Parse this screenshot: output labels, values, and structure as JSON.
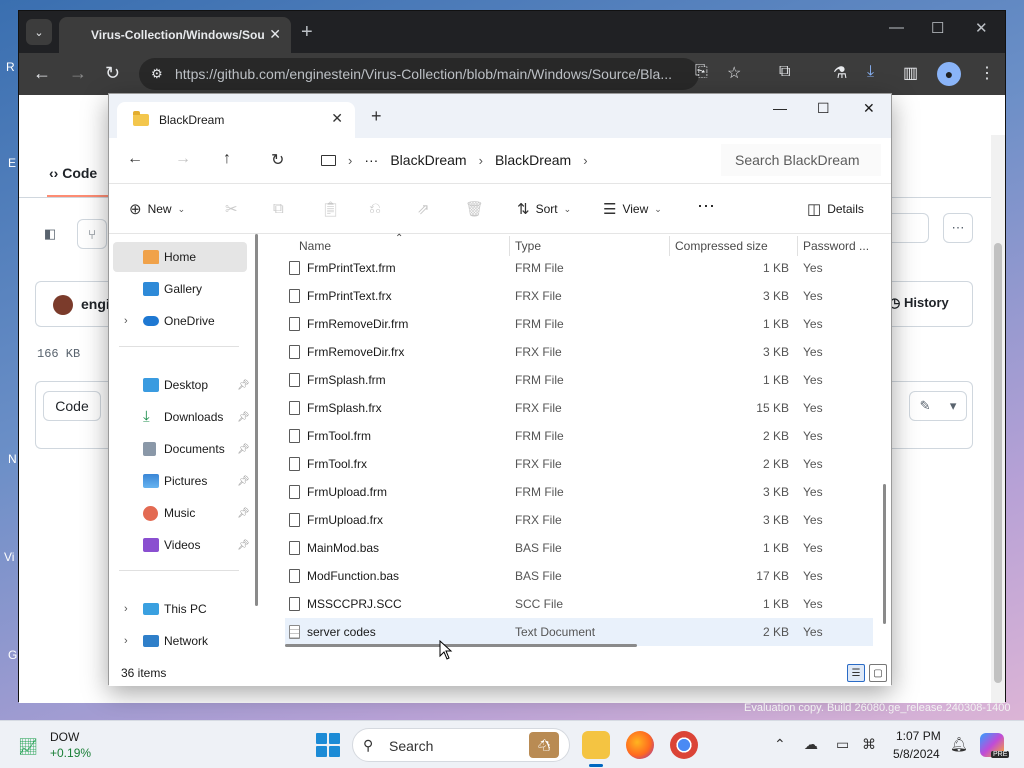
{
  "desktop": {
    "edge_letters": [
      "R",
      "E",
      "N",
      "Vi",
      "G"
    ]
  },
  "browser": {
    "tab_title": "Virus-Collection/Windows/Sou",
    "url": "https://github.com/enginestein/Virus-Collection/blob/main/Windows/Source/Bla..."
  },
  "github": {
    "code_tab": "Code",
    "author": "engi",
    "file_size": "166 KB",
    "code_button": "Code",
    "history": "History"
  },
  "explorer": {
    "tab_title": "BlackDream",
    "breadcrumb": [
      "BlackDream",
      "BlackDream"
    ],
    "search_placeholder": "Search BlackDream",
    "cmd": {
      "new": "New",
      "sort": "Sort",
      "view": "View",
      "details": "Details"
    },
    "nav": [
      {
        "label": "Home",
        "icon": "home-icon",
        "selected": true
      },
      {
        "label": "Gallery",
        "icon": "gallery-icon"
      },
      {
        "label": "OneDrive",
        "icon": "cloud-icon",
        "expandable": true
      },
      {
        "label": "Desktop",
        "icon": "desktop-icon",
        "pinned": true
      },
      {
        "label": "Downloads",
        "icon": "download-icon",
        "pinned": true
      },
      {
        "label": "Documents",
        "icon": "documents-icon",
        "pinned": true
      },
      {
        "label": "Pictures",
        "icon": "pictures-icon",
        "pinned": true
      },
      {
        "label": "Music",
        "icon": "music-icon",
        "pinned": true
      },
      {
        "label": "Videos",
        "icon": "videos-icon",
        "pinned": true
      },
      {
        "label": "This PC",
        "icon": "pc-icon",
        "expandable": true
      },
      {
        "label": "Network",
        "icon": "network-icon",
        "expandable": true
      }
    ],
    "columns": [
      "Name",
      "Type",
      "Compressed size",
      "Password ..."
    ],
    "files": [
      {
        "name": "FrmPrintText.frm",
        "type": "FRM File",
        "size": "1 KB",
        "password": "Yes"
      },
      {
        "name": "FrmPrintText.frx",
        "type": "FRX File",
        "size": "3 KB",
        "password": "Yes"
      },
      {
        "name": "FrmRemoveDir.frm",
        "type": "FRM File",
        "size": "1 KB",
        "password": "Yes"
      },
      {
        "name": "FrmRemoveDir.frx",
        "type": "FRX File",
        "size": "3 KB",
        "password": "Yes"
      },
      {
        "name": "FrmSplash.frm",
        "type": "FRM File",
        "size": "1 KB",
        "password": "Yes"
      },
      {
        "name": "FrmSplash.frx",
        "type": "FRX File",
        "size": "15 KB",
        "password": "Yes"
      },
      {
        "name": "FrmTool.frm",
        "type": "FRM File",
        "size": "2 KB",
        "password": "Yes"
      },
      {
        "name": "FrmTool.frx",
        "type": "FRX File",
        "size": "2 KB",
        "password": "Yes"
      },
      {
        "name": "FrmUpload.frm",
        "type": "FRM File",
        "size": "3 KB",
        "password": "Yes"
      },
      {
        "name": "FrmUpload.frx",
        "type": "FRX File",
        "size": "3 KB",
        "password": "Yes"
      },
      {
        "name": "MainMod.bas",
        "type": "BAS File",
        "size": "1 KB",
        "password": "Yes"
      },
      {
        "name": "ModFunction.bas",
        "type": "BAS File",
        "size": "17 KB",
        "password": "Yes"
      },
      {
        "name": "MSSCCPRJ.SCC",
        "type": "SCC File",
        "size": "1 KB",
        "password": "Yes"
      },
      {
        "name": "server codes",
        "type": "Text Document",
        "size": "2 KB",
        "password": "Yes",
        "selected": true
      }
    ],
    "status": "36 items"
  },
  "watermark": "Evaluation copy. Build 26080.ge_release.240308-1400",
  "taskbar": {
    "stock_name": "DOW",
    "stock_change": "+0.19%",
    "search_label": "Search",
    "time": "1:07 PM",
    "date": "5/8/2024",
    "copilot_badge": "PRE"
  },
  "colors": {
    "accent": "#0067c0",
    "stock_up": "#1a7f37",
    "folder": "#f3c64c"
  }
}
